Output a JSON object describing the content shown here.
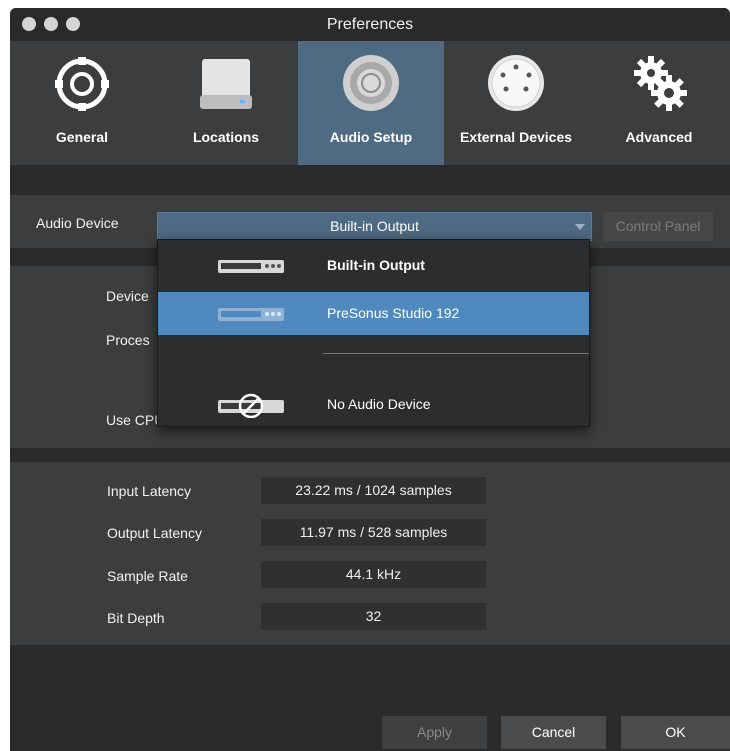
{
  "window": {
    "title": "Preferences"
  },
  "tabs": [
    {
      "label": "General",
      "icon": "sync-icon"
    },
    {
      "label": "Locations",
      "icon": "drive-icon"
    },
    {
      "label": "Audio Setup",
      "icon": "speaker-icon",
      "active": true
    },
    {
      "label": "External Devices",
      "icon": "midi-connector-icon"
    },
    {
      "label": "Advanced",
      "icon": "gears-icon"
    }
  ],
  "audio_device": {
    "label": "Audio Device",
    "selected": "Built-in Output",
    "control_panel": "Control Panel"
  },
  "dropdown": {
    "items": [
      {
        "label": "Built-in Output",
        "bold": true
      },
      {
        "label": "PreSonus Studio 192",
        "highlighted": true
      },
      {
        "label": "No Audio Device"
      }
    ]
  },
  "device_panel": {
    "partial_labels": {
      "device": "Device",
      "process": "Proces",
      "cpu": "Use CPU Cores"
    }
  },
  "latency": {
    "rows": [
      {
        "label": "Input Latency",
        "value": "23.22 ms / 1024 samples"
      },
      {
        "label": "Output Latency",
        "value": "11.97 ms / 528 samples"
      },
      {
        "label": "Sample Rate",
        "value": "44.1 kHz"
      },
      {
        "label": "Bit Depth",
        "value": "32"
      }
    ]
  },
  "buttons": {
    "apply": "Apply",
    "cancel": "Cancel",
    "ok": "OK"
  },
  "colors": {
    "accent": "#4f6a83",
    "highlight": "#4f89bd",
    "panel": "#3c3d3e"
  }
}
